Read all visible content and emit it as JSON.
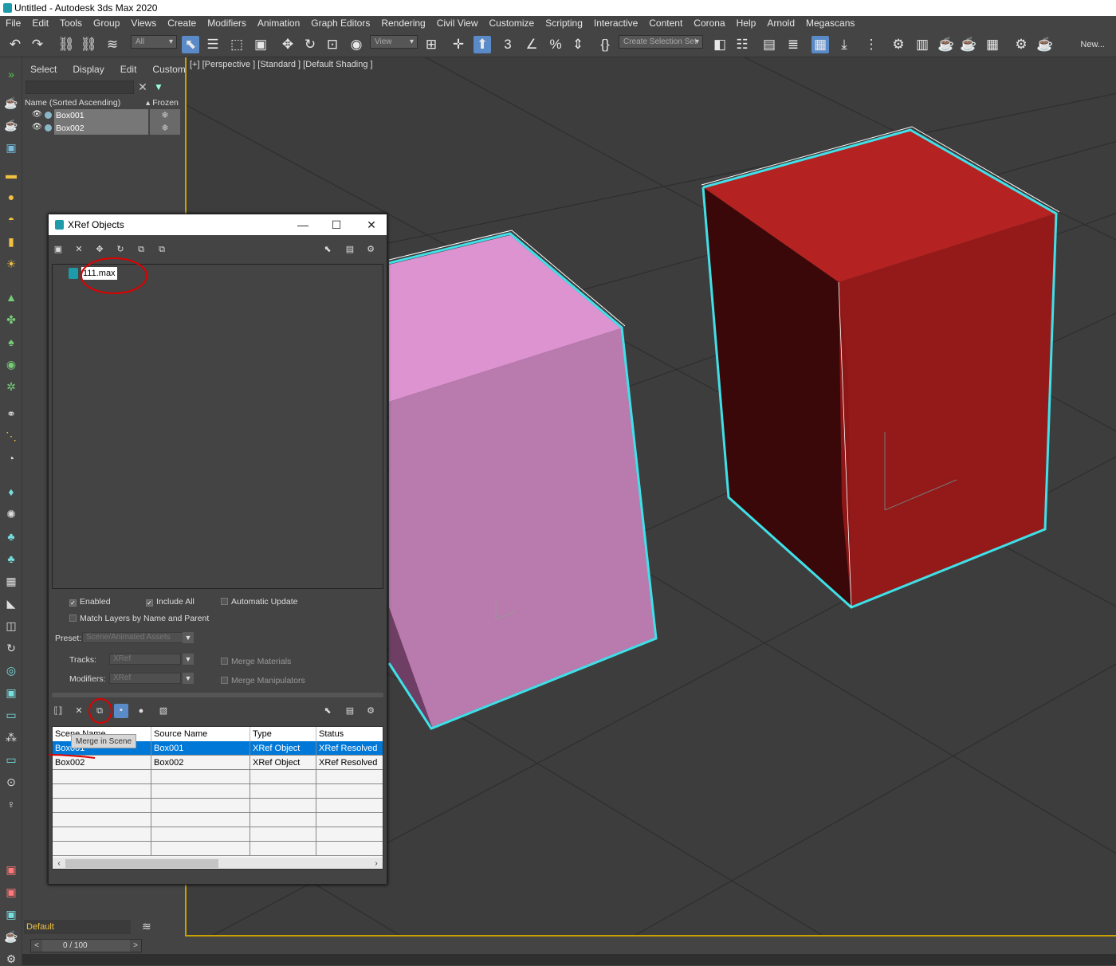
{
  "window": {
    "title": "Untitled - Autodesk 3ds Max 2020"
  },
  "menu": [
    "File",
    "Edit",
    "Tools",
    "Group",
    "Views",
    "Create",
    "Modifiers",
    "Animation",
    "Graph Editors",
    "Rendering",
    "Civil View",
    "Customize",
    "Scripting",
    "Interactive",
    "Content",
    "Corona",
    "Help",
    "Arnold",
    "Megascans"
  ],
  "toolbar": {
    "filter_value": "All",
    "view_value": "View",
    "selection_set_placeholder": "Create Selection Set",
    "new_label": "New..."
  },
  "explorer": {
    "tabs": [
      "Select",
      "Display",
      "Edit",
      "Customize"
    ],
    "name_header": "Name (Sorted Ascending)",
    "frozen_header": "Frozen",
    "objects": [
      "Box001",
      "Box002"
    ],
    "layer": "Default"
  },
  "viewport": {
    "label": "[+] [Perspective ] [Standard ] [Default Shading ]",
    "colors": {
      "pink_box": "#d48cc4",
      "red_box": "#a01c1c",
      "selection": "#40e0e8"
    }
  },
  "timeline": {
    "value": "0 / 100",
    "prev": "<",
    "next": ">"
  },
  "xref": {
    "title": "XRef Objects",
    "file": "111.max",
    "options": {
      "enabled": "Enabled",
      "include_all": "Include All",
      "automatic_update": "Automatic Update",
      "match_layers": "Match Layers by Name and Parent",
      "preset_label": "Preset:",
      "preset_value": "Scene/Animated Assets",
      "tracks_label": "Tracks:",
      "tracks_value": "XRef",
      "modifiers_label": "Modifiers:",
      "modifiers_value": "XRef",
      "merge_materials": "Merge Materials",
      "merge_manipulators": "Merge Manipulators"
    },
    "tooltip": "Merge in Scene",
    "table": {
      "headers": [
        "Scene Name",
        "Source Name",
        "Type",
        "Status"
      ],
      "rows": [
        [
          "Box001",
          "Box001",
          "XRef Object",
          "XRef Resolved"
        ],
        [
          "Box002",
          "Box002",
          "XRef Object",
          "XRef Resolved"
        ]
      ]
    }
  }
}
